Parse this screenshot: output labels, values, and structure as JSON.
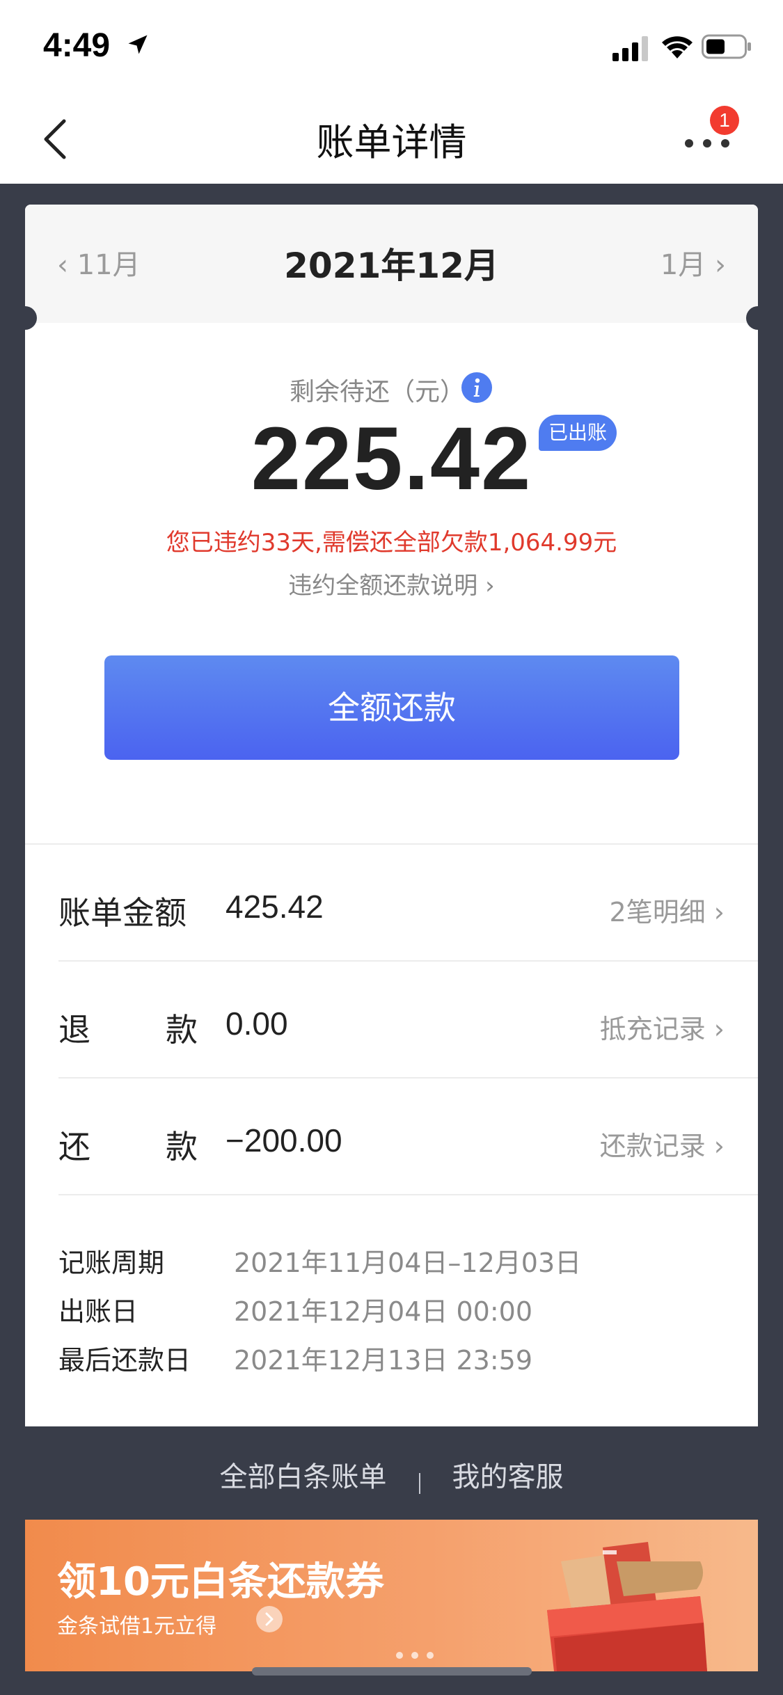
{
  "status_bar": {
    "time": "4:49"
  },
  "nav": {
    "title": "账单详情",
    "badge_count": "1"
  },
  "month_nav": {
    "prev": "11月",
    "current": "2021年12月",
    "next": "1月"
  },
  "summary": {
    "remain_label": "剩余待还（元）",
    "remain_amount": "225.42",
    "status_tag": "已出账",
    "overdue_warning": "您已违约33天,需偿还全部欠款1,064.99元",
    "overdue_link": "违约全额还款说明",
    "pay_button": "全额还款"
  },
  "rows": [
    {
      "label": "账单金额",
      "value": "425.42",
      "link": "2笔明细"
    },
    {
      "label_left": "退",
      "label_right": "款",
      "value": "0.00",
      "link": "抵充记录"
    },
    {
      "label_left": "还",
      "label_right": "款",
      "value": "−200.00",
      "link": "还款记录"
    }
  ],
  "meta": [
    {
      "label": "记账周期",
      "value": "2021年11月04日–12月03日"
    },
    {
      "label": "出账日",
      "value": "2021年12月04日 00:00"
    },
    {
      "label": "最后还款日",
      "value": "2021年12月13日 23:59"
    }
  ],
  "footer": {
    "all_bills": "全部白条账单",
    "customer_service": "我的客服"
  },
  "banner": {
    "title": "领10元白条还款券",
    "subtitle": "金条试借1元立得"
  },
  "colors": {
    "accent_blue": "#4b63f0",
    "warning_red": "#e0392c",
    "banner_orange": "#f18b4c",
    "page_bg": "#393d49"
  }
}
